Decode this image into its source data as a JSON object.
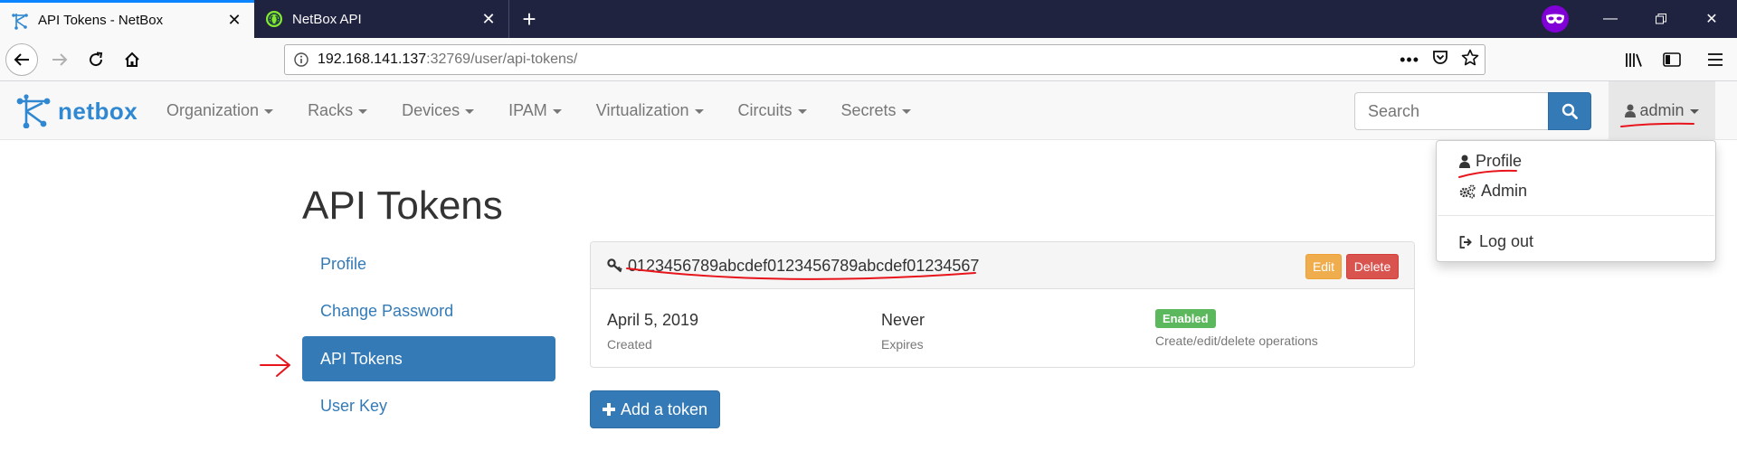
{
  "browser": {
    "tabs": [
      {
        "title": "API Tokens - NetBox",
        "active": true
      },
      {
        "title": "NetBox API",
        "active": false
      }
    ],
    "url": {
      "host": "192.168.141.137",
      "path": ":32769/user/api-tokens/"
    }
  },
  "navbar": {
    "brand": "netbox",
    "menu": [
      "Organization",
      "Racks",
      "Devices",
      "IPAM",
      "Virtualization",
      "Circuits",
      "Secrets"
    ],
    "search_placeholder": "Search",
    "user": "admin"
  },
  "user_dropdown": {
    "items": [
      "Profile",
      "Admin",
      "Log out"
    ]
  },
  "page": {
    "title": "API Tokens",
    "sidebar": [
      "Profile",
      "Change Password",
      "API Tokens",
      "User Key"
    ],
    "active_sidebar": "API Tokens"
  },
  "token": {
    "key": "0123456789abcdef0123456789abcdef01234567",
    "edit_label": "Edit",
    "delete_label": "Delete",
    "created_value": "April 5, 2019",
    "created_label": "Created",
    "expires_value": "Never",
    "expires_label": "Expires",
    "status_badge": "Enabled",
    "status_note": "Create/edit/delete operations"
  },
  "add_button": "Add a token",
  "colors": {
    "primary": "#337ab7",
    "warning": "#f0ad4e",
    "danger": "#d9534f",
    "success": "#5cb85c",
    "annotation": "#e8141b"
  }
}
